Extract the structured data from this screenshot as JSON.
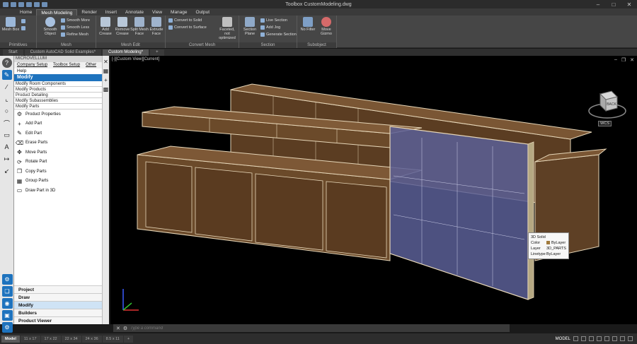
{
  "window": {
    "title": "Toolbox   CustomModeling.dwg"
  },
  "app_button": "A",
  "ribbon_tabs": [
    "Home",
    "Mesh Modeling",
    "Render",
    "Insert",
    "Annotate",
    "View",
    "Manage",
    "Output"
  ],
  "ribbon": {
    "primitives": {
      "label": "Primitives",
      "mesh_box": "Mesh Box"
    },
    "mesh": {
      "label": "Mesh",
      "smooth_object": "Smooth Object",
      "smooth_more": "Smooth More",
      "smooth_less": "Smooth Less",
      "refine_mesh": "Refine Mesh"
    },
    "mesh_edit": {
      "label": "Mesh Edit",
      "add_crease": "Add Crease",
      "remove_crease": "Remove Crease",
      "split_mesh_face": "Split Mesh Face",
      "extrude_face": "Extrude Face"
    },
    "convert_mesh": {
      "label": "Convert Mesh",
      "convert_to_solid": "Convert to Solid",
      "convert_to_surface": "Convert to Surface",
      "faceted_not_optimized": "Faceted, not optimized"
    },
    "section": {
      "label": "Section",
      "section_plane": "Section Plane",
      "live_section": "Live Section",
      "add_jog": "Add Jog",
      "generate_section": "Generate Section"
    },
    "subobject": {
      "label": "Subobject",
      "no_filter": "No Filter",
      "move_gizmo": "Move Gizmo"
    }
  },
  "doc_tabs": [
    "Start",
    "Custom AutoCAD Solid Examples*",
    "Custom Modeling*",
    "+"
  ],
  "microvellum": {
    "header": "MICROVELLUM",
    "menus": [
      "Company Setup",
      "Toolbox Setup",
      "Other"
    ],
    "help": "Help",
    "section_title": "Modify",
    "categories": [
      "Modify Room Components",
      "Modify Products",
      "Product Detailing",
      "Modify Subassemblies",
      "Modify Parts"
    ],
    "commands": [
      "Product Properties",
      "Add Part",
      "Edit Part",
      "Erase Parts",
      "Move Parts",
      "Rotate Part",
      "Copy Parts",
      "Group Parts",
      "Draw Part in 3D"
    ],
    "bottom_nav": [
      "Project",
      "Draw",
      "Modify",
      "Builders",
      "Product Viewer"
    ],
    "active_nav": "Modify"
  },
  "viewport": {
    "label": "[-][Custom View][Current]",
    "wcs": "WCS",
    "viewcube_face": "BACK"
  },
  "tooltip": {
    "title": "3D Solid",
    "rows": [
      {
        "key": "Color",
        "value": "ByLayer"
      },
      {
        "key": "Layer",
        "value": "3D_PARTS"
      },
      {
        "key": "Linetype",
        "value": "ByLayer"
      }
    ],
    "swatch_color": "#a07a3c"
  },
  "command_line": {
    "placeholder": "Type a command"
  },
  "status": {
    "layout_tabs": [
      "Model",
      "11 x 17",
      "17 x 22",
      "22 x 34",
      "24 x 36",
      "8.5 x 11",
      "+"
    ],
    "space": "MODEL"
  },
  "colors": {
    "wood": "#6b4a2a",
    "wood_edge": "#d8c7a8",
    "panel": "#5a5f96",
    "accent": "#1e73be"
  }
}
